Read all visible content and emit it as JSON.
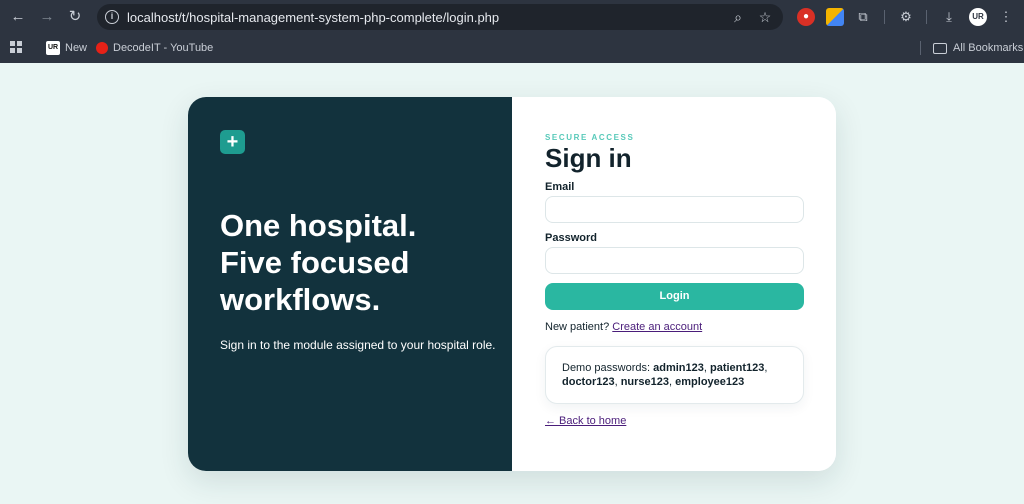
{
  "browser": {
    "url": "localhost/t/hospital-management-system-php-complete/login.php",
    "avatar_initials": "UR",
    "bookmarks": [
      {
        "label": "New",
        "icon": "ur-logo-icon"
      },
      {
        "label": "DecodeIT - YouTube",
        "icon": "youtube-icon"
      }
    ],
    "all_bookmarks_label": "All Bookmarks"
  },
  "brand": {
    "logo_glyph": "+",
    "accent": "#1e9c90",
    "panel_color": "#12323d",
    "button_color": "#2ab7a1"
  },
  "hero": {
    "lines": [
      "One hospital.",
      "Five focused",
      "workflows."
    ],
    "subtitle": "Sign in to the module assigned to your hospital role."
  },
  "form": {
    "eyebrow": "SECURE ACCESS",
    "title": "Sign in",
    "email_label": "Email",
    "email_value": "",
    "password_label": "Password",
    "password_value": "",
    "submit_label": "Login",
    "new_patient_text": "New patient?",
    "create_account_link": "Create an account"
  },
  "demo": {
    "prefix": "Demo passwords:",
    "passwords": [
      "admin123",
      "patient123",
      "doctor123",
      "nurse123",
      "employee123"
    ]
  },
  "back_link": "← Back to home"
}
